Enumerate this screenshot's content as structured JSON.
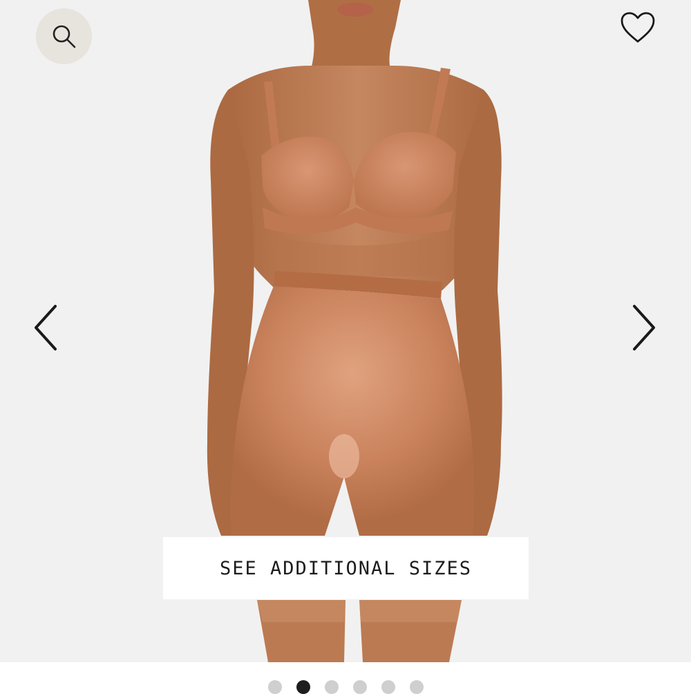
{
  "icons": {
    "search": "search-icon",
    "wishlist": "heart-outline-icon",
    "previous": "chevron-left-icon",
    "next": "chevron-right-icon"
  },
  "product_image": {
    "subject": "model wearing tan bra and high-waisted satin shorts",
    "colors": {
      "background": "#f1f1f1",
      "skin": "#b9774f",
      "garment": "#c7805a",
      "garment_highlight": "#da9c78",
      "waistband": "#b46c45"
    }
  },
  "cta": {
    "label": "SEE ADDITIONAL SIZES"
  },
  "carousel": {
    "total_slides": 6,
    "active_index": 1
  },
  "colors": {
    "search_bg": "#e7e4de",
    "dot_inactive": "#cfcfcf",
    "dot_active": "#1e1e1e",
    "text": "#1c1c1c"
  }
}
